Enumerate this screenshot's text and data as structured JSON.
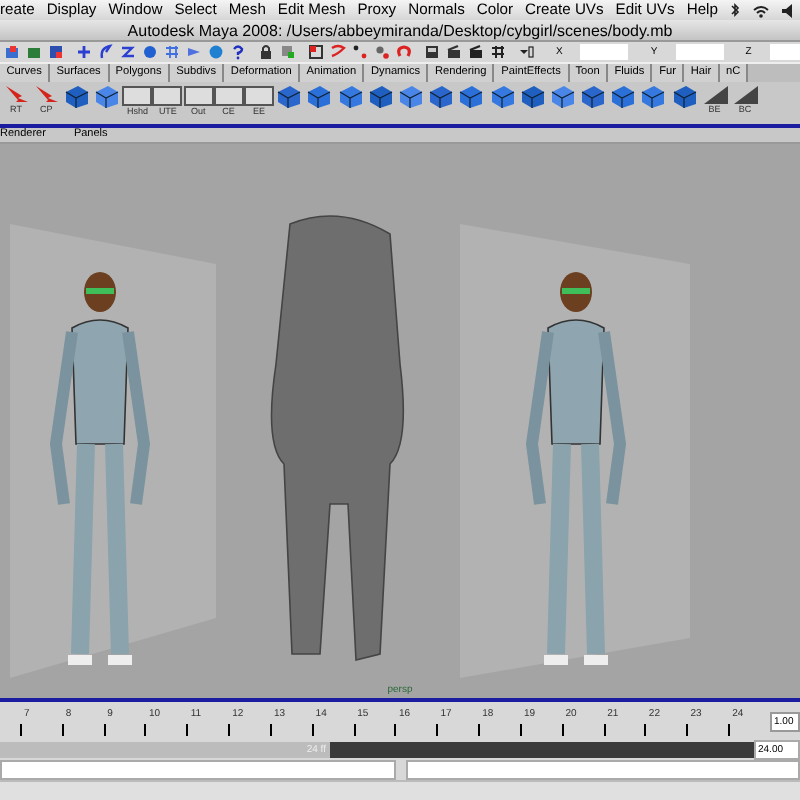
{
  "menu_bar": {
    "items": [
      "reate",
      "Display",
      "Window",
      "Select",
      "Mesh",
      "Edit Mesh",
      "Proxy",
      "Normals",
      "Color",
      "Create UVs",
      "Edit UVs",
      "Help"
    ]
  },
  "title_bar": {
    "title": "Autodesk Maya 2008: /Users/abbeymiranda/Desktop/cybgirl/scenes/body.mb"
  },
  "status_line": {
    "axis_labels": [
      "X",
      "Y",
      "Z"
    ]
  },
  "shelf": {
    "tabs": [
      "Curves",
      "Surfaces",
      "Polygons",
      "Subdivs",
      "Deformation",
      "Animation",
      "Dynamics",
      "Rendering",
      "PaintEffects",
      "Toon",
      "Fluids",
      "Fur",
      "Hair",
      "nC"
    ],
    "tools": [
      {
        "kind": "arrow",
        "label": "RT"
      },
      {
        "kind": "arrow",
        "label": "CP"
      },
      {
        "kind": "icon"
      },
      {
        "kind": "icon"
      },
      {
        "kind": "box",
        "label": "Hshd"
      },
      {
        "kind": "box",
        "label": "UTE"
      },
      {
        "kind": "box",
        "label": "Out"
      },
      {
        "kind": "box",
        "label": "CE"
      },
      {
        "kind": "box",
        "label": "EE"
      },
      {
        "kind": "icon"
      },
      {
        "kind": "icon"
      },
      {
        "kind": "icon"
      },
      {
        "kind": "icon"
      },
      {
        "kind": "icon"
      },
      {
        "kind": "icon"
      },
      {
        "kind": "icon"
      },
      {
        "kind": "icon"
      },
      {
        "kind": "icon"
      },
      {
        "kind": "icon"
      },
      {
        "kind": "icon"
      },
      {
        "kind": "icon"
      },
      {
        "kind": "icon"
      },
      {
        "kind": "icon"
      },
      {
        "kind": "corner",
        "label": "BE"
      },
      {
        "kind": "corner",
        "label": "BC"
      }
    ]
  },
  "panel_menu": [
    "Renderer",
    "Panels"
  ],
  "viewport": {
    "camera": "persp"
  },
  "time_slider": {
    "ticks": [
      "7",
      "8",
      "9",
      "10",
      "11",
      "12",
      "13",
      "14",
      "15",
      "16",
      "17",
      "18",
      "19",
      "20",
      "21",
      "22",
      "23",
      "24"
    ],
    "current_frame": "1.00"
  },
  "range_slider": {
    "end_label": "24 ff",
    "end_field": "24.00"
  }
}
